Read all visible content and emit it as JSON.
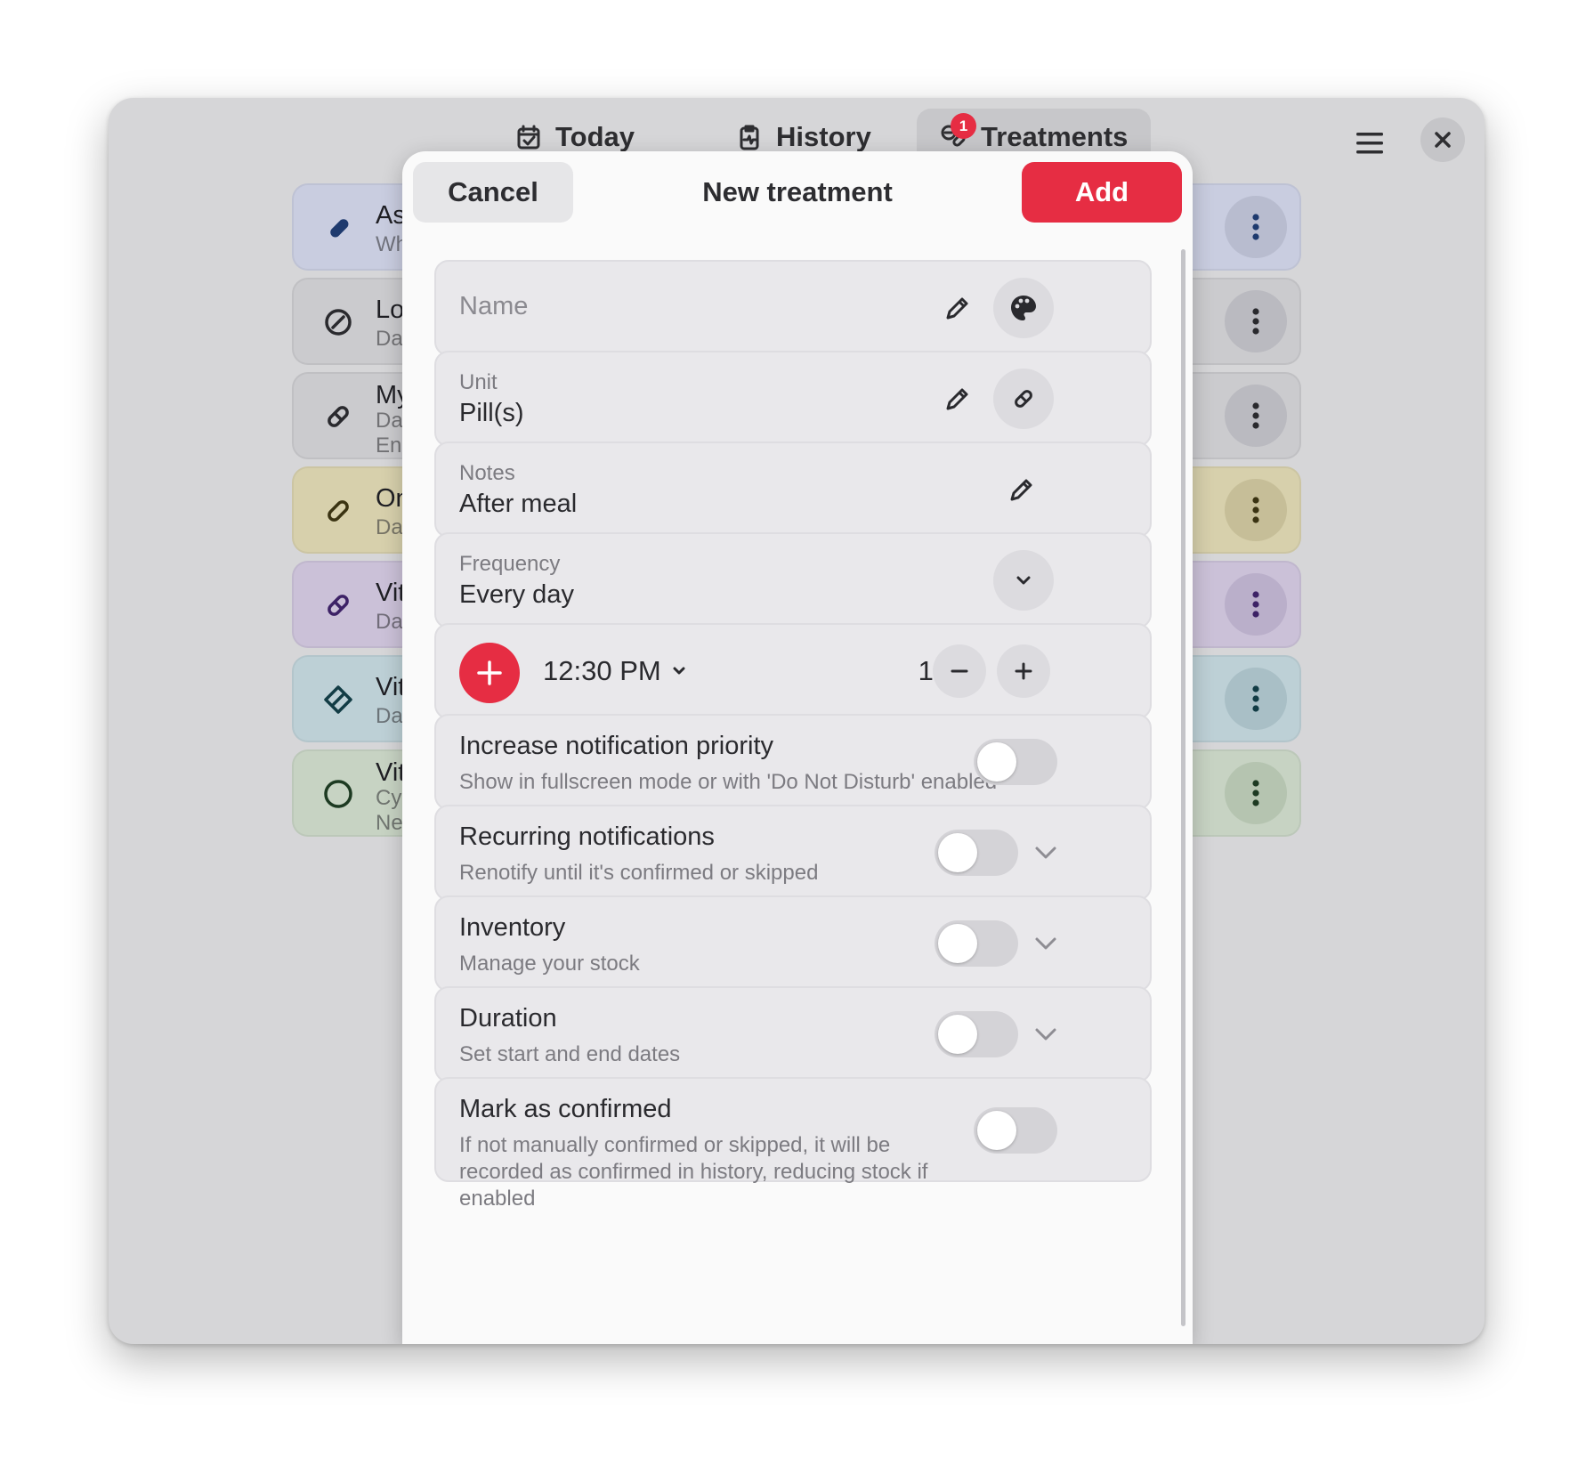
{
  "tabs": [
    {
      "label": "Today",
      "icon": "calendar-check-icon"
    },
    {
      "label": "History",
      "icon": "clipboard-pulse-icon"
    },
    {
      "label": "Treatments",
      "icon": "pills-icon",
      "badge": "1"
    }
  ],
  "background_list": [
    {
      "title": "As",
      "sub": "Wh",
      "color": "#c9cde0",
      "accent": "#1e3a6e"
    },
    {
      "title": "Lo",
      "sub": "Da",
      "color": "#cbcbce",
      "accent": "#2a2a2e"
    },
    {
      "title": "My",
      "sub": "Da",
      "sub2": "End",
      "color": "#cbcbce",
      "accent": "#2a2a2e"
    },
    {
      "title": "On",
      "sub": "Da",
      "color": "#d7d0ac",
      "accent": "#3a3312"
    },
    {
      "title": "Vit",
      "sub": "Da",
      "color": "#cbc1d8",
      "accent": "#3d2266"
    },
    {
      "title": "Vit",
      "sub": "Da",
      "color": "#bdd0d6",
      "accent": "#123c45"
    },
    {
      "title": "Vit",
      "sub": "Cyc",
      "sub2": "Ne",
      "color": "#c7d3c3",
      "accent": "#1d3a22"
    }
  ],
  "modal": {
    "cancel_label": "Cancel",
    "title": "New treatment",
    "add_label": "Add",
    "name": {
      "placeholder": "Name"
    },
    "unit": {
      "label": "Unit",
      "value": "Pill(s)"
    },
    "notes": {
      "label": "Notes",
      "value": "After meal"
    },
    "frequency": {
      "label": "Frequency",
      "value": "Every day"
    },
    "dose_row": {
      "time": "12:30 PM",
      "amount": "1.00"
    },
    "toggles": [
      {
        "title": "Increase notification priority",
        "subtitle": "Show in fullscreen mode or with 'Do Not Disturb' enabled",
        "on": false
      },
      {
        "title": "Recurring notifications",
        "subtitle": "Renotify until it's confirmed or skipped",
        "on": false
      },
      {
        "title": "Inventory",
        "subtitle": "Manage your stock",
        "on": false
      },
      {
        "title": "Duration",
        "subtitle": "Set start and end dates",
        "on": false
      },
      {
        "title": "Mark as confirmed",
        "subtitle": "If not manually confirmed or skipped, it will be recorded as confirmed in history, reducing stock if enabled",
        "on": false
      }
    ]
  },
  "colors": {
    "accent": "#e62d43",
    "window_bg": "#d6d6d8",
    "modal_bg": "#fafafa"
  }
}
